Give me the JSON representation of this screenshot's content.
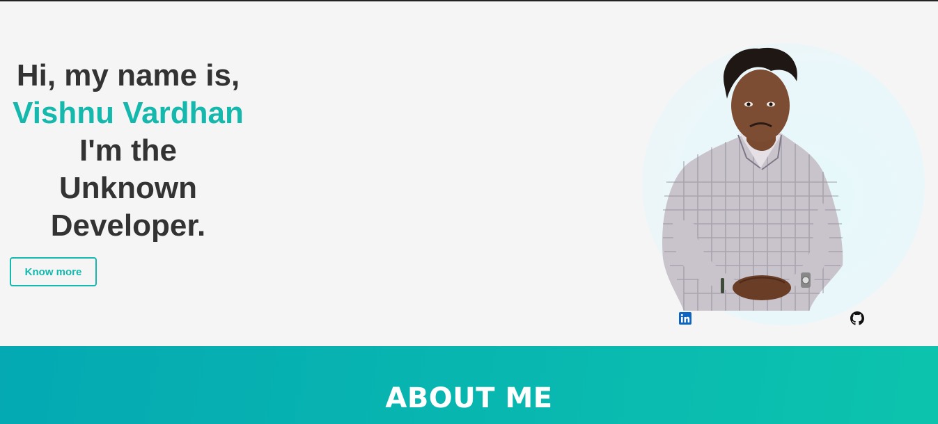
{
  "hero": {
    "greeting": "Hi, my name is,",
    "name": "Vishnu Vardhan",
    "line3": "I'm the",
    "line4": "Unknown",
    "line5": "Developer.",
    "cta_label": "Know more"
  },
  "social": {
    "linkedin_icon": "linkedin-icon",
    "github_icon": "github-icon"
  },
  "about": {
    "heading": "ABOUT ME"
  },
  "colors": {
    "accent": "#14b8ac",
    "text": "#333333",
    "background": "#f5f5f5",
    "about_gradient_start": "#04a9b3",
    "about_gradient_end": "#0cc4ae"
  }
}
